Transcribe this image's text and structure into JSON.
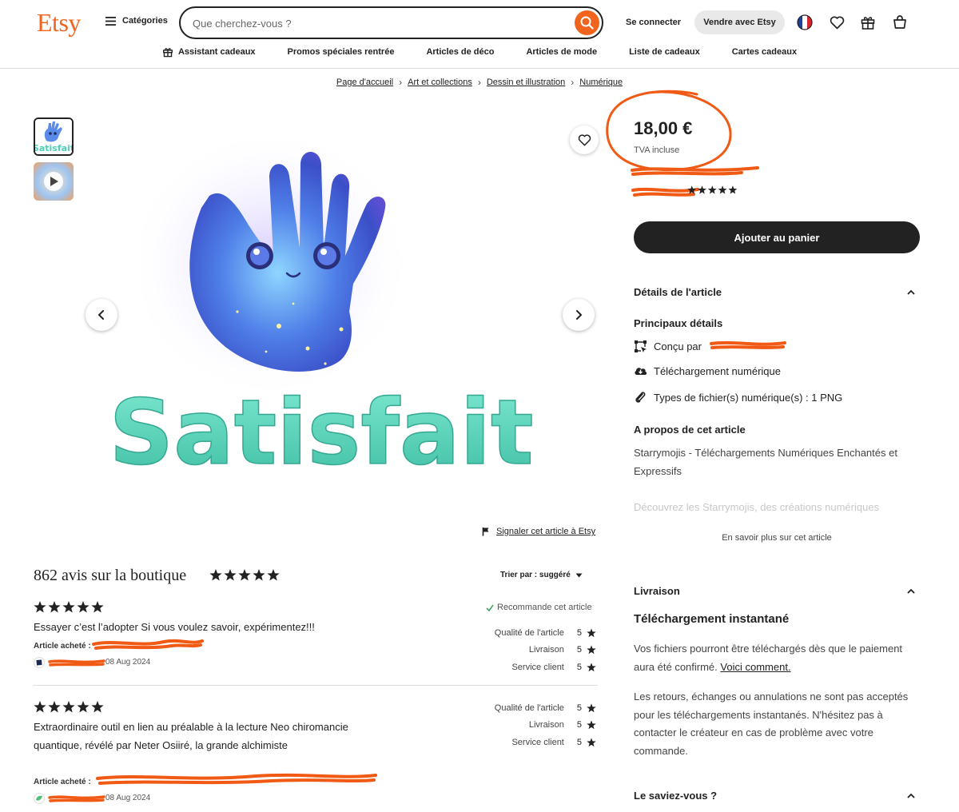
{
  "header": {
    "logo": "Etsy",
    "categories_label": "Catégories",
    "search_placeholder": "Que cherchez-vous ?",
    "signin_label": "Se connecter",
    "sell_label": "Vendre avec Etsy",
    "icons": [
      "france-flag-icon",
      "heart-icon",
      "gift-icon",
      "cart-icon"
    ]
  },
  "nav": [
    "Assistant cadeaux",
    "Promos spéciales rentrée",
    "Articles de déco",
    "Articles de mode",
    "Liste de cadeaux",
    "Cartes cadeaux"
  ],
  "breadcrumb": [
    "Page d'accueil",
    "Art et collections",
    "Dessin et illustration",
    "Numérique"
  ],
  "gallery": {
    "main_image_caption": "Satisfait",
    "report_label": "Signaler cet article à Etsy"
  },
  "product": {
    "price": "18,00 €",
    "vat": "TVA incluse",
    "add_to_cart": "Ajouter au panier",
    "details_heading": "Détails de l'article",
    "main_details_heading": "Principaux détails",
    "designed_by": "Conçu par",
    "digital_download": "Téléchargement numérique",
    "file_types": "Types de fichier(s) numérique(s) : 1 PNG",
    "about_heading": "A propos de cet article",
    "about_text": "Starrymojis - Téléchargements Numériques Enchantés et Expressifs",
    "about_fade": "Découvrez les Starrymojis, des créations numériques",
    "learn_more": "En savoir plus sur cet article"
  },
  "shipping": {
    "heading": "Livraison",
    "instant_title": "Téléchargement instantané",
    "text_1": "Vos fichiers pourront être téléchargés dès que le paiement aura été confirmé.",
    "how_link": "Voici comment.",
    "text_2": "Les retours, échanges ou annulations ne sont pas acceptés pour les téléchargements instantanés. N'hésitez pas à contacter le créateur en cas de problème avec votre commande."
  },
  "did_you_know": {
    "heading": "Le saviez-vous ?"
  },
  "reviews": {
    "title": "862 avis sur la boutique",
    "rating": 5,
    "sort_label": "Trier par : suggéré",
    "items": [
      {
        "stars": 5,
        "text": "Essayer c’est l’adopter Si vous voulez savoir, expérimentez!!!",
        "purchased_label": "Article acheté :",
        "date": "08 Aug 2024",
        "recommend": "Recommande cet article",
        "ratings": [
          {
            "label": "Qualité de l'article",
            "value": "5"
          },
          {
            "label": "Livraison",
            "value": "5"
          },
          {
            "label": "Service client",
            "value": "5"
          }
        ]
      },
      {
        "stars": 5,
        "text": "Extraordinaire outil en lien au préalable à la lecture Neo chiromancie quantique, révélé par Neter Osiiré, la grande alchimiste",
        "purchased_label": "Article acheté :",
        "date": "08 Aug 2024",
        "ratings": [
          {
            "label": "Qualité de l'article",
            "value": "5"
          },
          {
            "label": "Livraison",
            "value": "5"
          },
          {
            "label": "Service client",
            "value": "5"
          }
        ]
      }
    ]
  },
  "colors": {
    "brand": "#f1641e",
    "annotation": "#f05a14",
    "button_dark": "#222222",
    "caption_teal": "#5fd9c0"
  }
}
